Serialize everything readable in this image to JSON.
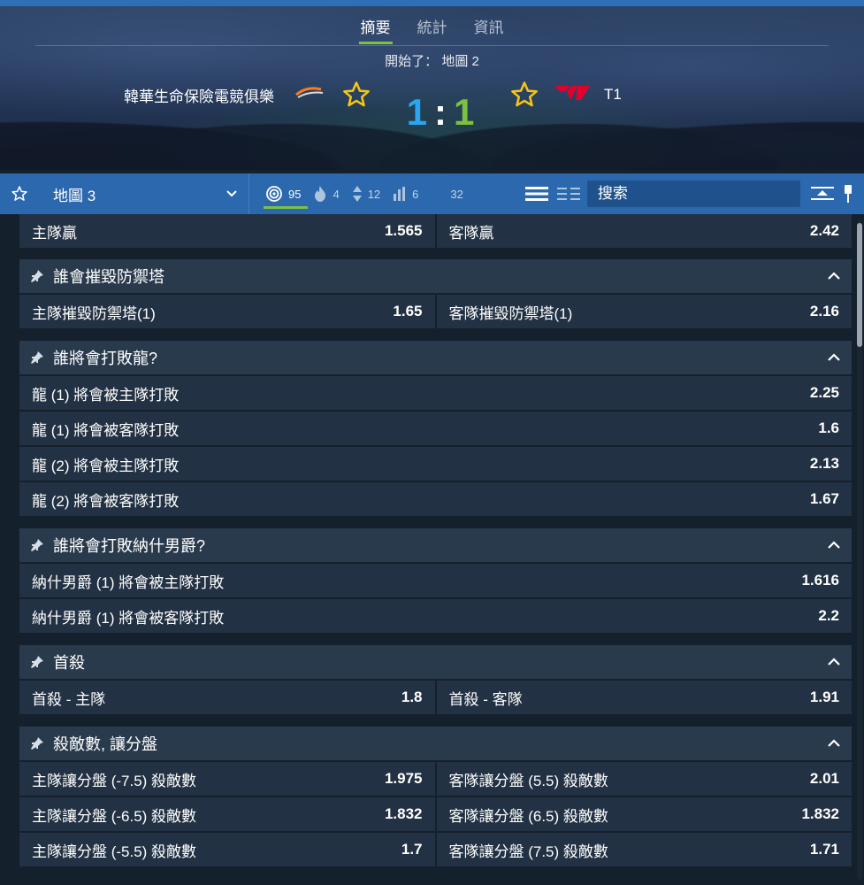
{
  "header": {
    "tabs": [
      {
        "label": "摘要",
        "active": true
      },
      {
        "label": "統計",
        "active": false
      },
      {
        "label": "資訊",
        "active": false
      }
    ],
    "status": "開始了： 地圖 2",
    "home_team": "韓華生命保險電競俱樂",
    "away_team": "T1",
    "home_score": "1",
    "away_score": "1",
    "score_separator": ":"
  },
  "toolbar": {
    "map_label": "地圖 3",
    "counters": [
      {
        "icon": "target-icon",
        "count": "95",
        "active": true
      },
      {
        "icon": "fire-icon",
        "count": "4",
        "active": false
      },
      {
        "icon": "updown-icon",
        "count": "12",
        "active": false
      },
      {
        "icon": "bar-chart-icon",
        "count": "6",
        "active": false
      }
    ],
    "total_count": "32",
    "search_placeholder": "搜索"
  },
  "markets": {
    "top_row": {
      "home_label": "主隊贏",
      "home_odds": "1.565",
      "away_label": "客隊贏",
      "away_odds": "2.42"
    },
    "tower": {
      "title": "誰會摧毀防禦塔",
      "home_label": "主隊摧毀防禦塔(1)",
      "home_odds": "1.65",
      "away_label": "客隊摧毀防禦塔(1)",
      "away_odds": "2.16"
    },
    "dragon": {
      "title": "誰將會打敗龍?",
      "rows": [
        {
          "label": "龍 (1) 將會被主隊打敗",
          "odds": "2.25"
        },
        {
          "label": "龍 (1) 將會被客隊打敗",
          "odds": "1.6"
        },
        {
          "label": "龍 (2) 將會被主隊打敗",
          "odds": "2.13"
        },
        {
          "label": "龍 (2) 將會被客隊打敗",
          "odds": "1.67"
        }
      ]
    },
    "baron": {
      "title": "誰將會打敗納什男爵?",
      "rows": [
        {
          "label": "納什男爵 (1) 將會被主隊打敗",
          "odds": "1.616"
        },
        {
          "label": "納什男爵 (1) 將會被客隊打敗",
          "odds": "2.2"
        }
      ]
    },
    "first_blood": {
      "title": "首殺",
      "home_label": "首殺 - 主隊",
      "home_odds": "1.8",
      "away_label": "首殺 - 客隊",
      "away_odds": "1.91"
    },
    "kills_handicap": {
      "title": "殺敵數, 讓分盤",
      "rows": [
        {
          "home_label": "主隊讓分盤 (-7.5) 殺敵數",
          "home_odds": "1.975",
          "away_label": "客隊讓分盤 (5.5) 殺敵數",
          "away_odds": "2.01"
        },
        {
          "home_label": "主隊讓分盤 (-6.5) 殺敵數",
          "home_odds": "1.832",
          "away_label": "客隊讓分盤 (6.5) 殺敵數",
          "away_odds": "1.832"
        },
        {
          "home_label": "主隊讓分盤 (-5.5) 殺敵數",
          "home_odds": "1.7",
          "away_label": "客隊讓分盤 (7.5) 殺敵數",
          "away_odds": "1.71"
        }
      ]
    }
  },
  "colors": {
    "accent_green": "#7cc142",
    "home_score_blue": "#2aa6f0",
    "toolbar_blue": "#2b68ad",
    "star_yellow": "#f5c518"
  }
}
